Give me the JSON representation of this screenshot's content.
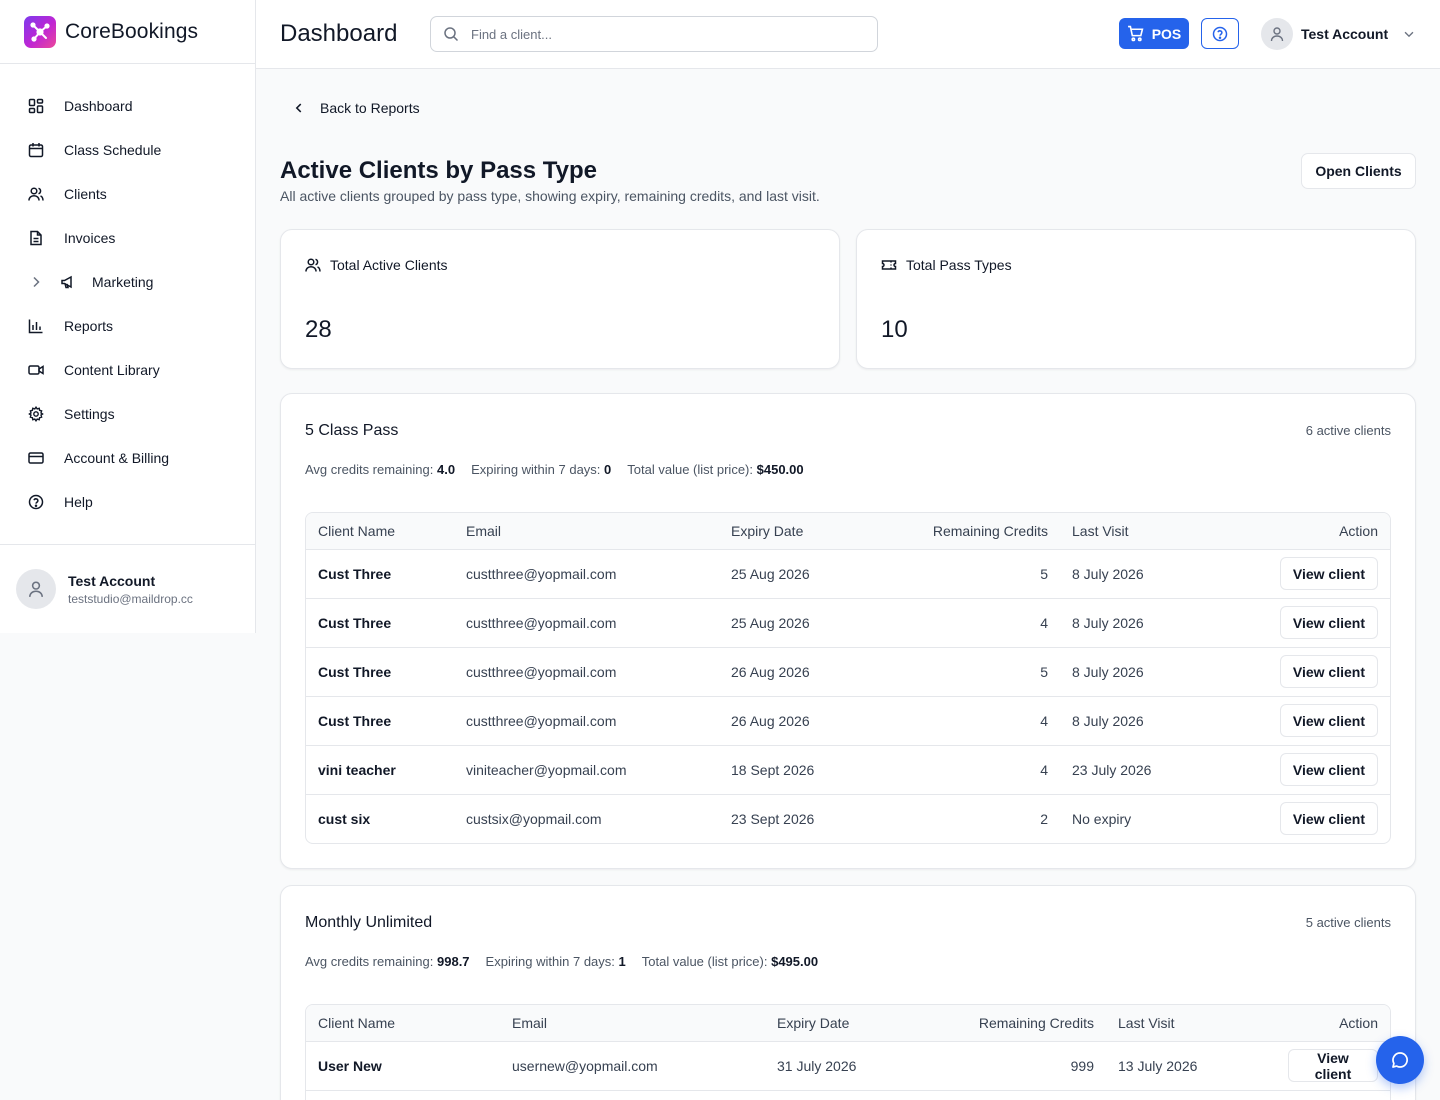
{
  "brand": {
    "name": "CoreBookings"
  },
  "sidebar": {
    "items": [
      {
        "label": "Dashboard",
        "icon": "grid-icon"
      },
      {
        "label": "Class Schedule",
        "icon": "calendar-icon"
      },
      {
        "label": "Clients",
        "icon": "users-icon"
      },
      {
        "label": "Invoices",
        "icon": "file-text-icon"
      },
      {
        "label": "Marketing",
        "icon": "megaphone-icon"
      },
      {
        "label": "Reports",
        "icon": "bar-chart-icon"
      },
      {
        "label": "Content Library",
        "icon": "video-icon"
      },
      {
        "label": "Settings",
        "icon": "gear-icon"
      },
      {
        "label": "Account & Billing",
        "icon": "credit-card-icon"
      },
      {
        "label": "Help",
        "icon": "help-circle-icon"
      }
    ],
    "user": {
      "name": "Test Account",
      "email": "teststudio@maildrop.cc"
    }
  },
  "header": {
    "title": "Dashboard",
    "search_placeholder": "Find a client...",
    "pos_label": "POS",
    "account_name": "Test Account"
  },
  "report": {
    "back_label": "Back to Reports",
    "title": "Active Clients by Pass Type",
    "subtitle": "All active clients grouped by pass type, showing expiry, remaining credits, and last visit.",
    "open_clients_label": "Open Clients"
  },
  "stats": {
    "total_clients_label": "Total Active Clients",
    "total_clients_value": "28",
    "total_pass_types_label": "Total Pass Types",
    "total_pass_types_value": "10"
  },
  "columns": {
    "name": "Client Name",
    "email": "Email",
    "expiry": "Expiry Date",
    "credits": "Remaining Credits",
    "last_visit": "Last Visit",
    "action": "Action"
  },
  "view_client_label": "View client",
  "groups": [
    {
      "title": "5 Class Pass",
      "count": "6 active clients",
      "avg_label": "Avg credits remaining:",
      "avg_value": "4.0",
      "expiring_label": "Expiring within 7 days:",
      "expiring_value": "0",
      "value_label": "Total value (list price):",
      "value_value": "$450.00",
      "rows": [
        {
          "name": "Cust Three",
          "email": "custthree@yopmail.com",
          "expiry": "25 Aug 2026",
          "credits": "5",
          "last_visit": "8 July 2026"
        },
        {
          "name": "Cust Three",
          "email": "custthree@yopmail.com",
          "expiry": "25 Aug 2026",
          "credits": "4",
          "last_visit": "8 July 2026"
        },
        {
          "name": "Cust Three",
          "email": "custthree@yopmail.com",
          "expiry": "26 Aug 2026",
          "credits": "5",
          "last_visit": "8 July 2026"
        },
        {
          "name": "Cust Three",
          "email": "custthree@yopmail.com",
          "expiry": "26 Aug 2026",
          "credits": "4",
          "last_visit": "8 July 2026"
        },
        {
          "name": "vini teacher",
          "email": "viniteacher@yopmail.com",
          "expiry": "18 Sept 2026",
          "credits": "4",
          "last_visit": "23 July 2026"
        },
        {
          "name": "cust six",
          "email": "custsix@yopmail.com",
          "expiry": "23 Sept 2026",
          "credits": "2",
          "last_visit": "No expiry"
        }
      ]
    },
    {
      "title": "Monthly Unlimited",
      "count": "5 active clients",
      "avg_label": "Avg credits remaining:",
      "avg_value": "998.7",
      "expiring_label": "Expiring within 7 days:",
      "expiring_value": "1",
      "value_label": "Total value (list price):",
      "value_value": "$495.00",
      "rows": [
        {
          "name": "User New",
          "email": "usernew@yopmail.com",
          "expiry": "31 July 2026",
          "credits": "999",
          "last_visit": "13 July 2026"
        },
        {
          "name": "",
          "email": "",
          "expiry": "",
          "credits": "",
          "last_visit": ""
        }
      ]
    }
  ],
  "colors": {
    "primary": "#2563eb",
    "brand_gradient_start": "#7c3aed",
    "brand_gradient_end": "#ec4899"
  }
}
